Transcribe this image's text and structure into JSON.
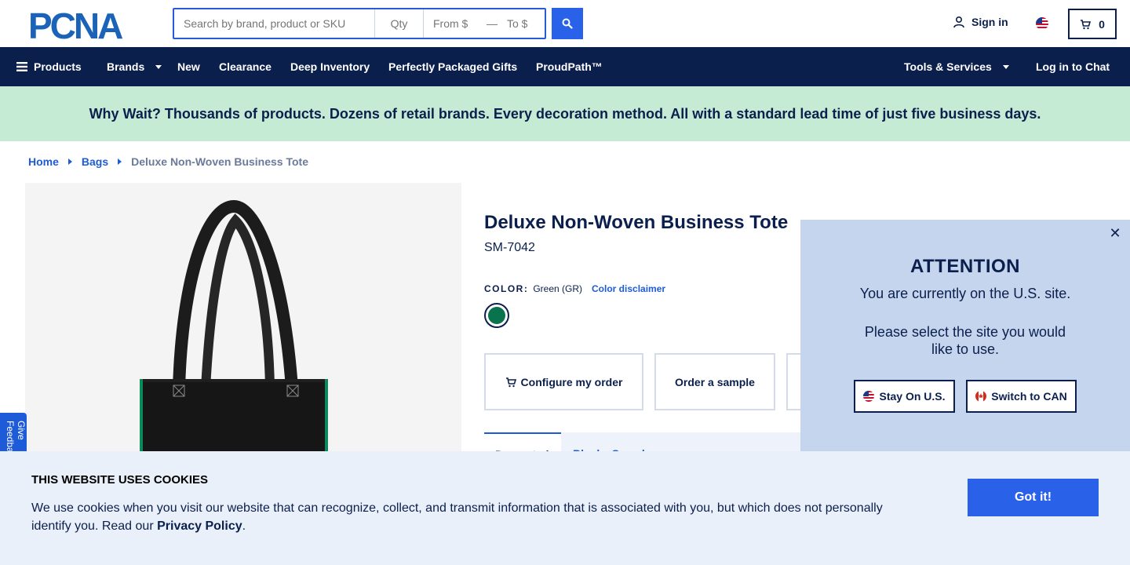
{
  "header": {
    "logo_text": "PCNA",
    "search": {
      "placeholder": "Search by brand, product or SKU",
      "qty_placeholder": "Qty",
      "from_placeholder": "From $",
      "to_placeholder": "To $"
    },
    "signin_label": "Sign in",
    "cart_count": "0"
  },
  "nav": {
    "products": "Products",
    "brands": "Brands",
    "new": "New",
    "clearance": "Clearance",
    "deep_inventory": "Deep Inventory",
    "gifts": "Perfectly Packaged Gifts",
    "proudpath": "ProudPath™",
    "tools": "Tools & Services",
    "chat": "Log in to Chat"
  },
  "promo": "Why Wait? Thousands of products. Dozens of retail brands. Every decoration method. All with a standard lead time of just five business days.",
  "breadcrumb": {
    "home": "Home",
    "bags": "Bags",
    "current": "Deluxe Non-Woven Business Tote"
  },
  "product": {
    "title": "Deluxe Non-Woven Business Tote",
    "sku": "SM-7042",
    "color_label": "COLOR:",
    "color_value": "Green (GR)",
    "color_disclaimer": "Color disclaimer",
    "swatch_color": "#08734d",
    "configure_label": "Configure my order",
    "sample_label": "Order a sample",
    "tab_active": "Decorated",
    "tab_other": "Blank",
    "tab_other2": "Samples"
  },
  "feedback": "Give Feedback",
  "attention": {
    "title": "ATTENTION",
    "text1": "You are currently on the U.S. site.",
    "text2": "Please select the site you would like to use.",
    "stay_label": "Stay On U.S.",
    "switch_label": "Switch to CAN"
  },
  "cookie": {
    "title": "THIS WEBSITE USES COOKIES",
    "text": "We use cookies when you visit our website that can recognize, collect, and transmit information that is associated with you, but which does not personally identify you. Read our ",
    "link": "Privacy Policy",
    "period": ".",
    "button": "Got it!"
  },
  "colors": {
    "navy": "#0b1f4d",
    "accent_blue": "#2962e8",
    "promo_bg": "#c5ebd5",
    "modal_bg": "#c5d5ee",
    "cookie_bg": "#eaf0fa"
  }
}
